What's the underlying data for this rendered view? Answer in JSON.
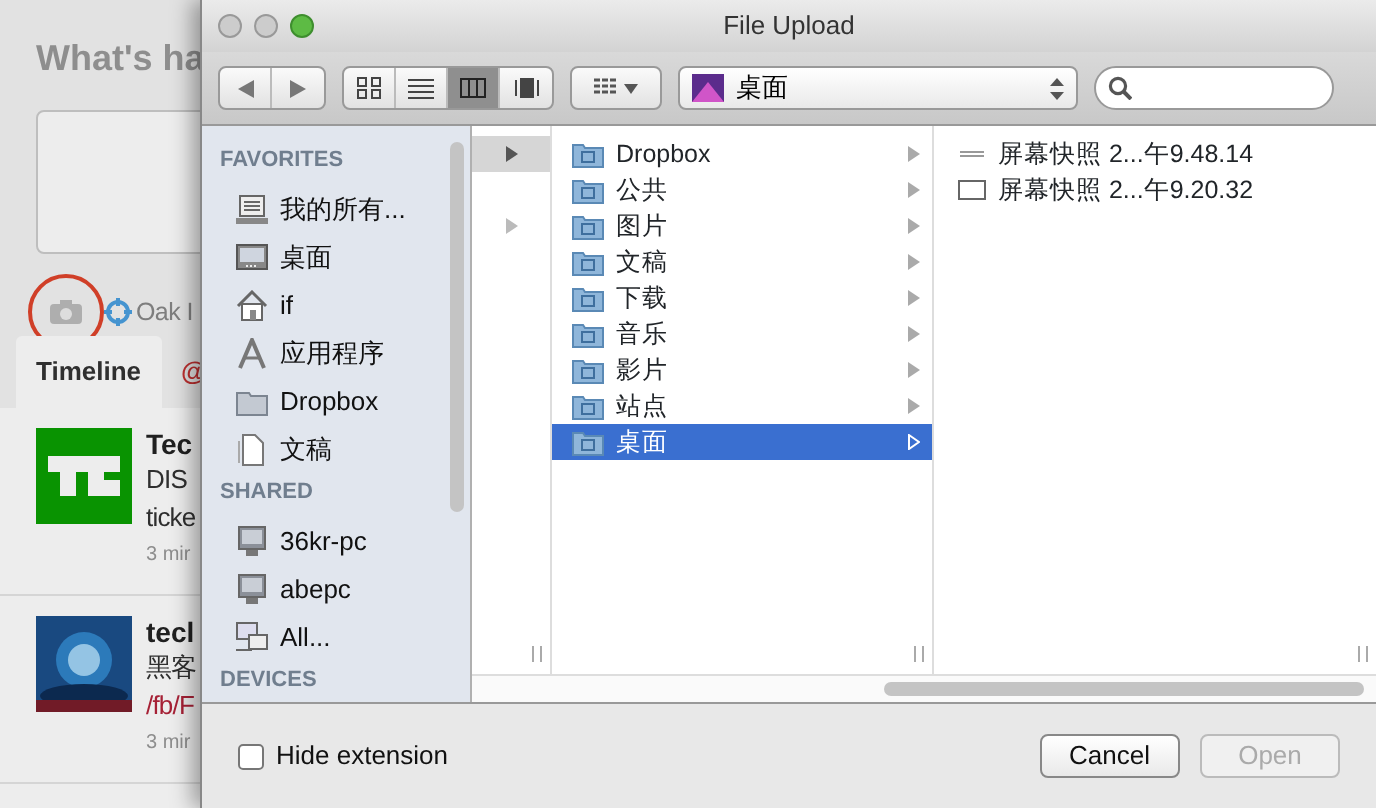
{
  "background_page": {
    "heading": "What's ha",
    "location": "Oak I",
    "tabs": [
      {
        "label": "Timeline",
        "selected": true
      },
      {
        "label": "@",
        "selected": false
      }
    ],
    "tweets": [
      {
        "kind": "logo",
        "name": "Tec",
        "lines": [
          {
            "kind": "text",
            "text": "DIS"
          },
          {
            "kind": "text",
            "text": "ticke"
          }
        ],
        "time": "3 mir"
      },
      {
        "kind": "picture",
        "name": "tecl",
        "lines": [
          {
            "kind": "text",
            "text": "黑客"
          },
          {
            "kind": "link",
            "text": "/fb/F"
          }
        ],
        "time": "3 mir"
      }
    ]
  },
  "dialog": {
    "title": "File Upload",
    "toolbar": {
      "views": [
        {
          "kind": "icons",
          "selected": false
        },
        {
          "kind": "list",
          "selected": false
        },
        {
          "kind": "columns",
          "selected": true
        },
        {
          "kind": "coverflow",
          "selected": false
        }
      ],
      "path": "桌面"
    },
    "sidebar": [
      {
        "heading": "FAVORITES",
        "items": [
          {
            "kind": "all",
            "label": "我的所有..."
          },
          {
            "kind": "desktop",
            "label": "桌面"
          },
          {
            "kind": "home",
            "label": "if"
          },
          {
            "kind": "apps",
            "label": "应用程序"
          },
          {
            "kind": "folder",
            "label": "Dropbox"
          },
          {
            "kind": "doc",
            "label": "文稿"
          }
        ]
      },
      {
        "heading": "SHARED",
        "items": [
          {
            "kind": "computer",
            "label": "36kr-pc"
          },
          {
            "kind": "computer",
            "label": "abepc"
          },
          {
            "kind": "network",
            "label": "All..."
          }
        ]
      },
      {
        "heading": "DEVICES"
      }
    ],
    "column_1": [
      {
        "selected": true
      },
      {
        "selected": false
      }
    ],
    "column_2": [
      {
        "label": "Dropbox",
        "selected": false
      },
      {
        "label": "公共",
        "selected": false
      },
      {
        "label": "图片",
        "selected": false
      },
      {
        "label": "文稿",
        "selected": false
      },
      {
        "label": "下载",
        "selected": false
      },
      {
        "label": "音乐",
        "selected": false
      },
      {
        "label": "影片",
        "selected": false
      },
      {
        "label": "站点",
        "selected": false
      },
      {
        "label": "桌面",
        "selected": true
      }
    ],
    "column_3": [
      {
        "kind": "plain",
        "label": "屏幕快照 2...午9.48.14"
      },
      {
        "kind": "window",
        "label": "屏幕快照 2...午9.20.32"
      }
    ],
    "hide_extension": {
      "label": "Hide extension",
      "checked": false
    },
    "buttons": [
      {
        "label": "Cancel",
        "disabled": false
      },
      {
        "label": "Open",
        "disabled": true
      }
    ]
  }
}
